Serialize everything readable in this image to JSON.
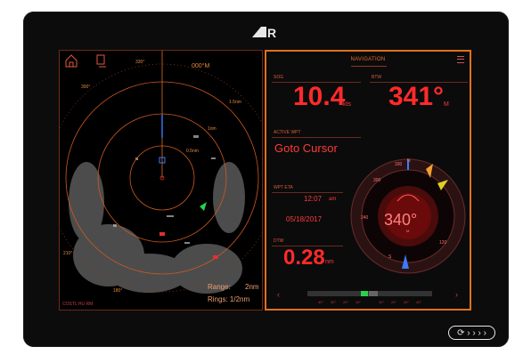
{
  "logo": "R",
  "radar": {
    "range_label": "Range:",
    "range_value": "2nm",
    "rings_label": "Rings: 1/2nm",
    "mode": "COSTL HU RM",
    "scale_labels": [
      "000°M",
      "030°",
      "060°",
      "090°",
      "120°",
      "150°",
      "180°",
      "210°",
      "240°",
      "270°",
      "300°",
      "330°"
    ],
    "ring_labels": [
      "1.5nm",
      "1nm",
      "0.5nm"
    ]
  },
  "navigation": {
    "title": "NAVIGATION",
    "sog": {
      "label": "SOG",
      "value": "10.4",
      "unit": "kts"
    },
    "btw": {
      "label": "BTW",
      "value": "341°",
      "unit": "M"
    },
    "active_wpt": {
      "label": "ACTIVE WPT",
      "value": "Goto Cursor"
    },
    "wpt_eta": {
      "label": "WPT ETA",
      "time": "12:07",
      "ampm": "am",
      "date": "05/18/2017"
    },
    "dtw": {
      "label": "DTW",
      "value": "0.28",
      "unit": "nm"
    },
    "compass": {
      "heading": "340°",
      "unit": "M",
      "labels": [
        "330",
        "N",
        "30",
        "60",
        "E",
        "120",
        "150",
        "S",
        "210",
        "240",
        "W",
        "300"
      ]
    },
    "bar_labels": [
      "40°",
      "30°",
      "20°",
      "10°",
      "10°",
      "20°",
      "30°",
      "40°"
    ]
  },
  "buttons_label": "⟳ › › › ›",
  "colors": {
    "accent": "#e0701f",
    "value": "#ff2a2a",
    "frame": "#0c0c0d"
  }
}
